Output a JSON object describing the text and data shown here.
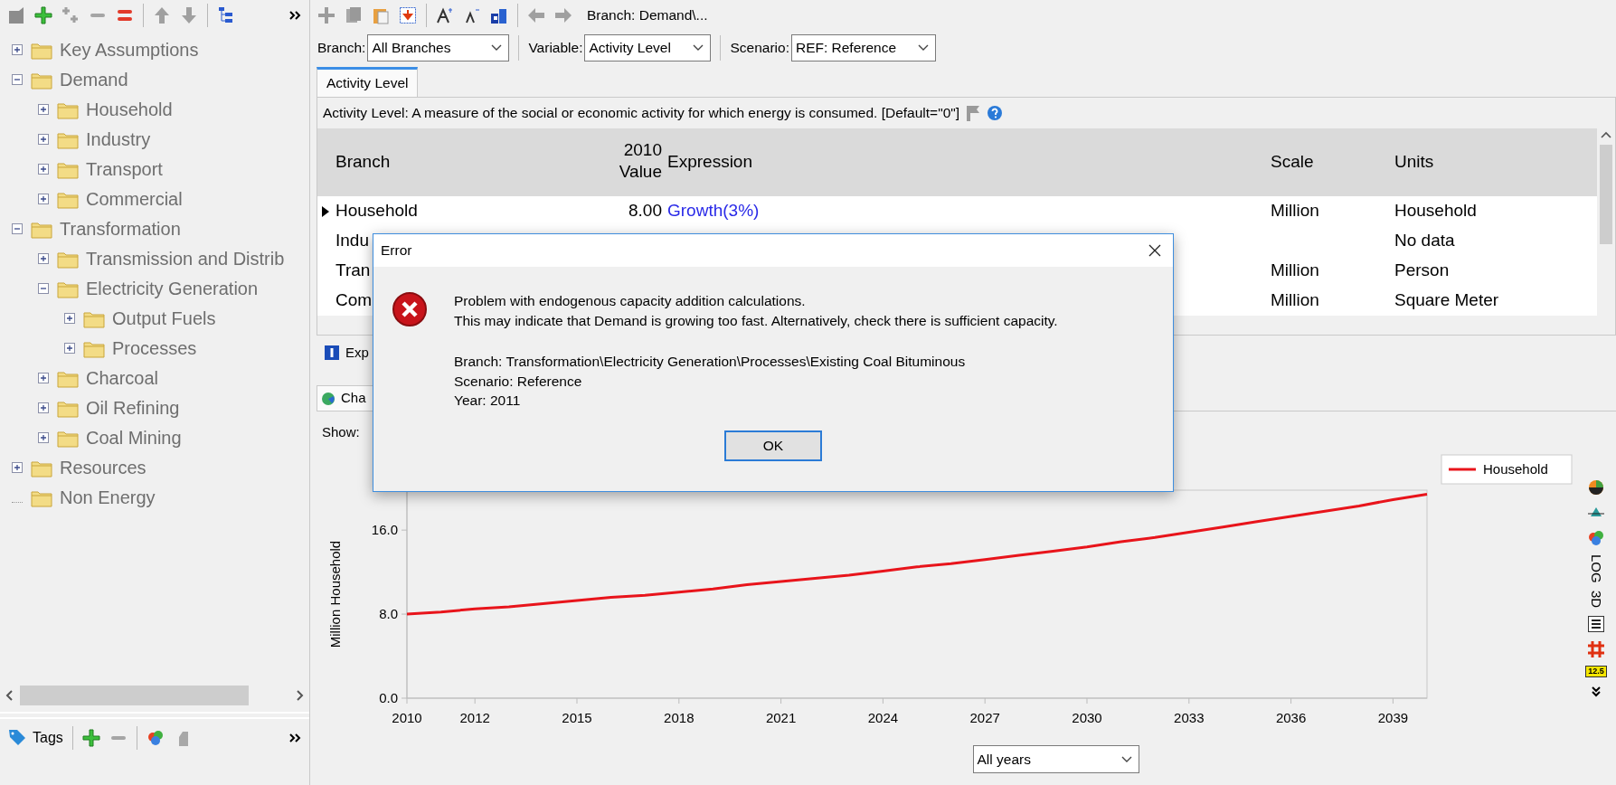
{
  "tree": [
    {
      "label": "Key Assumptions",
      "expanded": false
    },
    {
      "label": "Demand",
      "expanded": true,
      "children": [
        {
          "label": "Household",
          "expanded": false
        },
        {
          "label": "Industry",
          "expanded": false
        },
        {
          "label": "Transport",
          "expanded": false
        },
        {
          "label": "Commercial",
          "expanded": false
        }
      ]
    },
    {
      "label": "Transformation",
      "expanded": true,
      "children": [
        {
          "label": "Transmission and Distrib",
          "expanded": false
        },
        {
          "label": "Electricity Generation",
          "expanded": true,
          "children": [
            {
              "label": "Output Fuels",
              "expanded": false
            },
            {
              "label": "Processes",
              "expanded": false
            }
          ]
        },
        {
          "label": "Charcoal",
          "expanded": false
        },
        {
          "label": "Oil Refining",
          "expanded": false
        },
        {
          "label": "Coal Mining",
          "expanded": false
        }
      ]
    },
    {
      "label": "Resources",
      "expanded": false
    },
    {
      "label": "Non Energy"
    }
  ],
  "tags_bar": {
    "label": "Tags"
  },
  "toolbar": {
    "breadcrumb": "Branch: Demand\\..."
  },
  "selectors": [
    {
      "label": "Branch:",
      "value": "All Branches"
    },
    {
      "label": "Variable:",
      "value": "Activity Level"
    },
    {
      "label": "Scenario:",
      "value": "REF: Reference"
    }
  ],
  "tabs": [
    {
      "label": "Activity Level",
      "selected": true
    }
  ],
  "description": "Activity Level: A measure of the social or economic activity for which energy is consumed. [Default=\"0\"]",
  "table": {
    "columns": [
      "Branch",
      "2010 Value",
      "Expression",
      "Scale",
      "Units"
    ],
    "rows": [
      {
        "selected": true,
        "branch": "Household",
        "value": "8.00",
        "expression": "Growth(3%)",
        "scale": "Million",
        "units": "Household"
      },
      {
        "selected": false,
        "branch": "Indu",
        "units": "No data"
      },
      {
        "selected": false,
        "branch": "Tran",
        "scale": "Million",
        "units": "Person"
      },
      {
        "selected": false,
        "branch": "Com",
        "scale": "Million",
        "units": "Square Meter"
      }
    ]
  },
  "expression_tab": {
    "label": "Exp"
  },
  "chart_panel": {
    "tab": "Cha",
    "show_label": "Show:",
    "period": "All years",
    "side_labels": [
      "LOG",
      "3D"
    ],
    "value_badge": "12.5",
    "chart_data": {
      "type": "line",
      "ylabel": "Million Household",
      "x": [
        2010,
        2011,
        2012,
        2013,
        2014,
        2015,
        2016,
        2017,
        2018,
        2019,
        2020,
        2021,
        2022,
        2023,
        2024,
        2025,
        2026,
        2027,
        2028,
        2029,
        2030,
        2031,
        2032,
        2033,
        2034,
        2035,
        2036,
        2037,
        2038,
        2039,
        2040
      ],
      "series": [
        {
          "name": "Household",
          "color": "#e8141b",
          "values": [
            8.0,
            8.2,
            8.5,
            8.7,
            9.0,
            9.3,
            9.6,
            9.8,
            10.1,
            10.4,
            10.8,
            11.1,
            11.4,
            11.7,
            12.1,
            12.5,
            12.8,
            13.2,
            13.6,
            14.0,
            14.4,
            14.9,
            15.3,
            15.8,
            16.3,
            16.8,
            17.3,
            17.8,
            18.3,
            18.9,
            19.4
          ]
        }
      ],
      "xlim": [
        2010,
        2040
      ],
      "ylim": [
        0,
        19.8
      ],
      "xticks": [
        2010,
        2012,
        2015,
        2018,
        2021,
        2024,
        2027,
        2030,
        2033,
        2036,
        2039
      ],
      "yticks": [
        {
          "value": 0,
          "label": "0.0"
        },
        {
          "value": 8,
          "label": "8.0"
        },
        {
          "value": 16,
          "label": "16.0"
        }
      ]
    }
  },
  "dialog": {
    "title": "Error",
    "message": [
      "Problem with endogenous capacity addition calculations.",
      "This may indicate that Demand is growing too fast.  Alternatively, check there is sufficient capacity."
    ],
    "details": [
      "Branch: Transformation\\Electricity Generation\\Processes\\Existing Coal Bituminous",
      "Scenario: Reference",
      "Year: 2011"
    ],
    "button": "OK"
  }
}
